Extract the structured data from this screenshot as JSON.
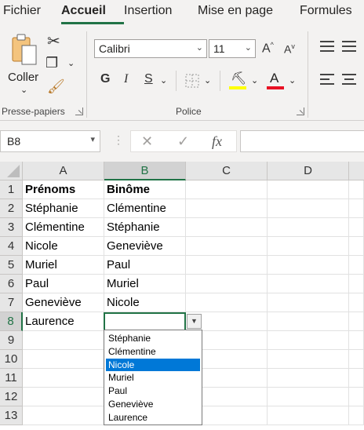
{
  "ribbon": {
    "tabs": [
      {
        "label": "Fichier",
        "active": false
      },
      {
        "label": "Accueil",
        "active": true
      },
      {
        "label": "Insertion",
        "active": false
      },
      {
        "label": "Mise en page",
        "active": false
      },
      {
        "label": "Formules",
        "active": false
      }
    ],
    "clipboard": {
      "paste_label": "Coller",
      "group_label": "Presse-papiers"
    },
    "font": {
      "font_name": "Calibri",
      "font_size": "11",
      "grow_label": "A",
      "shrink_label": "A",
      "bold_label": "G",
      "italic_label": "I",
      "underline_label": "S",
      "font_color_label": "A",
      "group_label": "Police",
      "highlight_color": "#ffff00",
      "font_color": "#e81123"
    }
  },
  "formula_bar": {
    "name_box": "B8",
    "fx_label": "fx",
    "cancel_glyph": "✕",
    "enter_glyph": "✓",
    "formula": ""
  },
  "sheet": {
    "columns": [
      "A",
      "B",
      "C",
      "D"
    ],
    "selected_column": "B",
    "rows": [
      {
        "num": "1",
        "A": "Prénoms",
        "B": "Binôme"
      },
      {
        "num": "2",
        "A": "Stéphanie",
        "B": "Clémentine"
      },
      {
        "num": "3",
        "A": "Clémentine",
        "B": "Stéphanie"
      },
      {
        "num": "4",
        "A": "Nicole",
        "B": "Geneviève"
      },
      {
        "num": "5",
        "A": "Muriel",
        "B": "Paul"
      },
      {
        "num": "6",
        "A": "Paul",
        "B": "Muriel"
      },
      {
        "num": "7",
        "A": "Geneviève",
        "B": "Nicole"
      },
      {
        "num": "8",
        "A": "Laurence",
        "B": ""
      },
      {
        "num": "9",
        "A": "",
        "B": ""
      },
      {
        "num": "10",
        "A": "",
        "B": ""
      },
      {
        "num": "11",
        "A": "",
        "B": ""
      },
      {
        "num": "12",
        "A": "",
        "B": ""
      },
      {
        "num": "13",
        "A": "",
        "B": ""
      }
    ],
    "selected_row": "8",
    "active_cell": "B8"
  },
  "validation_dropdown": {
    "items": [
      "Stéphanie",
      "Clémentine",
      "Nicole",
      "Muriel",
      "Paul",
      "Geneviève",
      "Laurence"
    ],
    "highlighted": "Nicole"
  },
  "colors": {
    "accent": "#217346",
    "selection": "#0078d7"
  }
}
